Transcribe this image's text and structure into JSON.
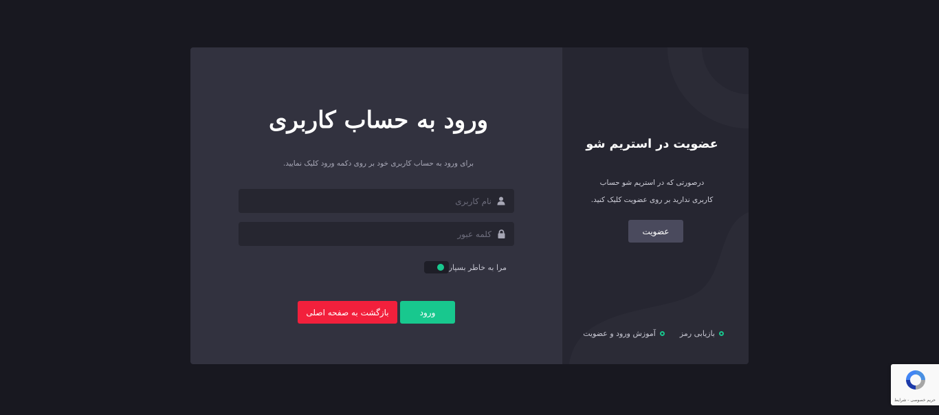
{
  "login": {
    "title": "ورود به حساب کاربری",
    "subtitle": "برای ورود به حساب کاربری خود بر روی دکمه ورود کلیک نمایید.",
    "username_placeholder": "نام کاربری",
    "password_placeholder": "کلمه عبور",
    "remember_label": "مرا به خاطر بسپار",
    "remember_on": true,
    "submit_label": "ورود",
    "back_label": "بازگشت به صفحه اصلی"
  },
  "signup": {
    "title": "عضویت در استریم شو",
    "text_line1": "درصورتی که در استریم شو حساب",
    "text_line2": "کاربری ندارید بر روی عضویت کلیک کنید.",
    "button_label": "عضویت",
    "links": [
      {
        "label": "بازیابی رمز"
      },
      {
        "label": "آموزش ورود و عضویت"
      }
    ]
  },
  "recaptcha": {
    "terms_text": "حریم خصوصی - شرایط"
  },
  "colors": {
    "accent": "#18c88e",
    "danger": "#f2203c",
    "page_bg": "#181820",
    "login_bg": "#32323f",
    "signup_bg": "#262631"
  },
  "icons": {
    "username": "user-icon",
    "password": "lock-icon",
    "link_bullet": "ring-dot-icon",
    "recaptcha": "recaptcha-logo-icon"
  }
}
